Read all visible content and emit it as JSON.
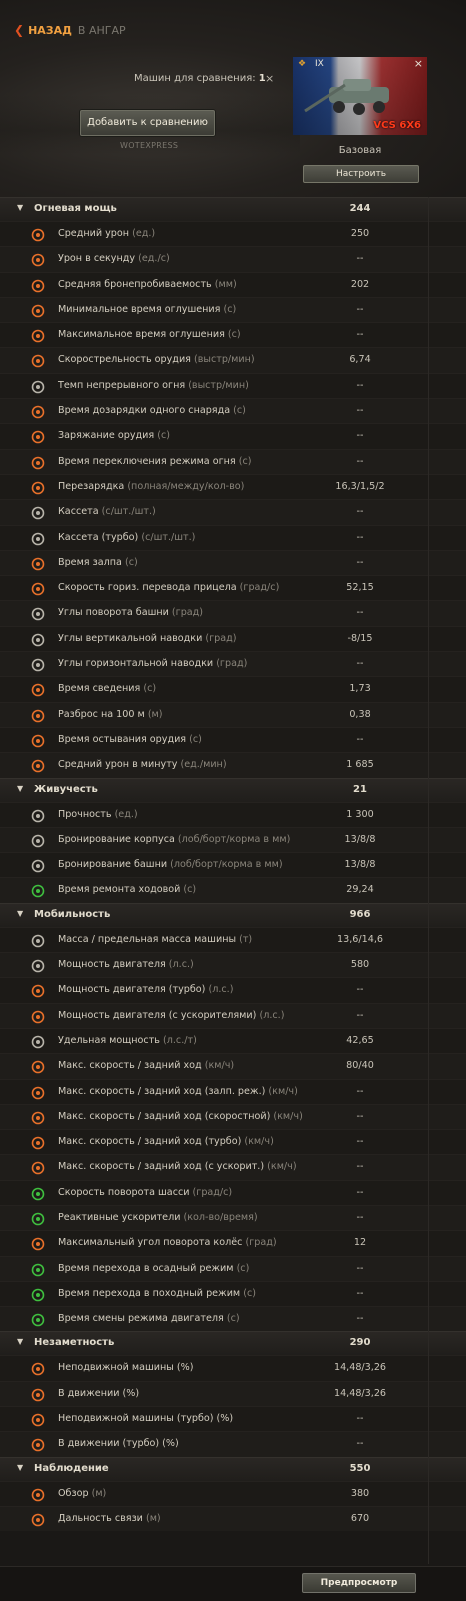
{
  "nav": {
    "back_icon": "❮",
    "back_label": "НАЗАД",
    "hangar_label": "В АНГАР"
  },
  "compare": {
    "count_label": "Машин для сравнения:",
    "count_value": "1",
    "close_icon": "×",
    "add_button": "Добавить к сравнению",
    "source_label": "WOTEXPRESS"
  },
  "vehicle": {
    "tier": "IX",
    "name": "VCS 6X6",
    "close_icon": "×",
    "config": "Базовая",
    "setup_button": "Настроить",
    "flag_colors": [
      "#1d3a78",
      "#e6e6e8",
      "#b33838"
    ]
  },
  "sections": [
    {
      "title": "Огневая мощь",
      "value": "244",
      "rows": [
        {
          "icon": "damage-icon",
          "label": "Средний урон",
          "unit": " (ед.)",
          "value": "250"
        },
        {
          "icon": "dps-icon",
          "label": "Урон в секунду",
          "unit": " (ед./с)",
          "value": "--"
        },
        {
          "icon": "penetration-icon",
          "label": "Средняя бронепробиваемость",
          "unit": " (мм)",
          "value": "202"
        },
        {
          "icon": "stun-min-icon",
          "label": "Минимальное время оглушения",
          "unit": " (с)",
          "value": "--"
        },
        {
          "icon": "stun-max-icon",
          "label": "Максимальное время оглушения",
          "unit": " (с)",
          "value": "--"
        },
        {
          "icon": "rate-of-fire-icon",
          "label": "Скорострельность орудия",
          "unit": " (выстр/мин)",
          "value": "6,74"
        },
        {
          "icon": "continuous-fire-icon",
          "label": "Темп непрерывного огня",
          "unit": " (выстр/мин)",
          "value": "--"
        },
        {
          "icon": "shell-reload-icon",
          "label": "Время дозарядки одного снаряда",
          "unit": " (с)",
          "value": "--"
        },
        {
          "icon": "gun-loading-icon",
          "label": "Заряжание орудия",
          "unit": " (с)",
          "value": "--"
        },
        {
          "icon": "fire-mode-switch-icon",
          "label": "Время переключения режима огня",
          "unit": " (с)",
          "value": "--"
        },
        {
          "icon": "reload-icon",
          "label": "Перезарядка",
          "unit": " (полная/между/кол-во)",
          "value": "16,3/1,5/2"
        },
        {
          "icon": "magazine-icon",
          "label": "Кассета",
          "unit": " (с/шт./шт.)",
          "value": "--"
        },
        {
          "icon": "magazine-turbo-icon",
          "label": "Кассета (турбо)",
          "unit": " (с/шт./шт.)",
          "value": "--"
        },
        {
          "icon": "salvo-time-icon",
          "label": "Время залпа",
          "unit": " (с)",
          "value": "--"
        },
        {
          "icon": "traverse-speed-icon",
          "label": "Скорость гориз. перевода прицела",
          "unit": " (град/с)",
          "value": "52,15"
        },
        {
          "icon": "turret-angles-icon",
          "label": "Углы поворота башни",
          "unit": " (град)",
          "value": "--"
        },
        {
          "icon": "elevation-angles-icon",
          "label": "Углы вертикальной наводки",
          "unit": " (град)",
          "value": "-8/15"
        },
        {
          "icon": "horizontal-angles-icon",
          "label": "Углы горизонтальной наводки",
          "unit": " (град)",
          "value": "--"
        },
        {
          "icon": "aim-time-icon",
          "label": "Время сведения",
          "unit": " (с)",
          "value": "1,73"
        },
        {
          "icon": "dispersion-icon",
          "label": "Разброс на 100 м",
          "unit": " (м)",
          "value": "0,38"
        },
        {
          "icon": "gun-cooling-icon",
          "label": "Время остывания орудия",
          "unit": " (с)",
          "value": "--"
        },
        {
          "icon": "damage-per-minute-icon",
          "label": "Средний урон в минуту",
          "unit": " (ед./мин)",
          "value": "1 685"
        }
      ]
    },
    {
      "title": "Живучесть",
      "value": "21",
      "rows": [
        {
          "icon": "hit-points-icon",
          "label": "Прочность",
          "unit": " (ед.)",
          "value": "1 300"
        },
        {
          "icon": "hull-armor-icon",
          "label": "Бронирование корпуса",
          "unit": " (лоб/борт/корма в мм)",
          "value": "13/8/8"
        },
        {
          "icon": "turret-armor-icon",
          "label": "Бронирование башни",
          "unit": " (лоб/борт/корма в мм)",
          "value": "13/8/8"
        },
        {
          "icon": "repair-time-icon",
          "label": "Время ремонта ходовой",
          "unit": " (с)",
          "value": "29,24"
        }
      ]
    },
    {
      "title": "Мобильность",
      "value": "966",
      "rows": [
        {
          "icon": "weight-icon",
          "label": "Масса / предельная масса машины",
          "unit": " (т)",
          "value": "13,6/14,6"
        },
        {
          "icon": "engine-power-icon",
          "label": "Мощность двигателя",
          "unit": " (л.с.)",
          "value": "580"
        },
        {
          "icon": "engine-power-turbo-icon",
          "label": "Мощность двигателя (турбо)",
          "unit": " (л.с.)",
          "value": "--"
        },
        {
          "icon": "engine-power-boost-icon",
          "label": "Мощность двигателя (с ускорителями)",
          "unit": " (л.с.)",
          "value": "--"
        },
        {
          "icon": "specific-power-icon",
          "label": "Удельная мощность",
          "unit": " (л.с./т)",
          "value": "42,65"
        },
        {
          "icon": "speed-limits-icon",
          "label": "Макс. скорость / задний ход",
          "unit": " (км/ч)",
          "value": "80/40"
        },
        {
          "icon": "speed-siege-icon",
          "label": "Макс. скорость / задний ход (залп. реж.)",
          "unit": " (км/ч)",
          "value": "--"
        },
        {
          "icon": "speed-fast-icon",
          "label": "Макс. скорость / задний ход (скоростной)",
          "unit": " (км/ч)",
          "value": "--"
        },
        {
          "icon": "speed-turbo-icon",
          "label": "Макс. скорость / задний ход (турбо)",
          "unit": " (км/ч)",
          "value": "--"
        },
        {
          "icon": "speed-boost-icon",
          "label": "Макс. скорость / задний ход (с ускорит.)",
          "unit": " (км/ч)",
          "value": "--"
        },
        {
          "icon": "chassis-rotation-icon",
          "label": "Скорость поворота шасси",
          "unit": " (град/с)",
          "value": "--"
        },
        {
          "icon": "rocket-boosters-icon",
          "label": "Реактивные ускорители",
          "unit": " (кол-во/время)",
          "value": "--"
        },
        {
          "icon": "wheel-angle-icon",
          "label": "Максимальный угол поворота колёс",
          "unit": " (град)",
          "value": "12"
        },
        {
          "icon": "siege-mode-icon",
          "label": "Время перехода в осадный режим",
          "unit": "  (с)",
          "value": "--"
        },
        {
          "icon": "travel-mode-icon",
          "label": "Время перехода в походный режим",
          "unit": "  (с)",
          "value": "--"
        },
        {
          "icon": "engine-mode-switch-icon",
          "label": "Время смены режима двигателя",
          "unit": " (с)",
          "value": "--"
        }
      ]
    },
    {
      "title": "Незаметность",
      "value": "290",
      "rows": [
        {
          "icon": "camo-still-icon",
          "label": "Неподвижной машины (%)",
          "unit": "",
          "value": "14,48/3,26"
        },
        {
          "icon": "camo-moving-icon",
          "label": "В движении (%)",
          "unit": "",
          "value": "14,48/3,26"
        },
        {
          "icon": "camo-still-turbo-icon",
          "label": "Неподвижной машины (турбо) (%)",
          "unit": "",
          "value": "--"
        },
        {
          "icon": "camo-moving-turbo-icon",
          "label": "В движении (турбо) (%)",
          "unit": "",
          "value": "--"
        }
      ]
    },
    {
      "title": "Наблюдение",
      "value": "550",
      "rows": [
        {
          "icon": "view-range-icon",
          "label": "Обзор",
          "unit": " (м)",
          "value": "380"
        },
        {
          "icon": "radio-range-icon",
          "label": "Дальность связи",
          "unit": " (м)",
          "value": "670"
        }
      ]
    }
  ],
  "footer": {
    "preview_button": "Предпросмотр"
  },
  "colors": {
    "accent": "#f0a040",
    "vehicle_name": "#ff3a1a",
    "icon_orange": "#e8702a",
    "icon_green": "#3fbf3f",
    "icon_grey": "#b8b4aa"
  }
}
